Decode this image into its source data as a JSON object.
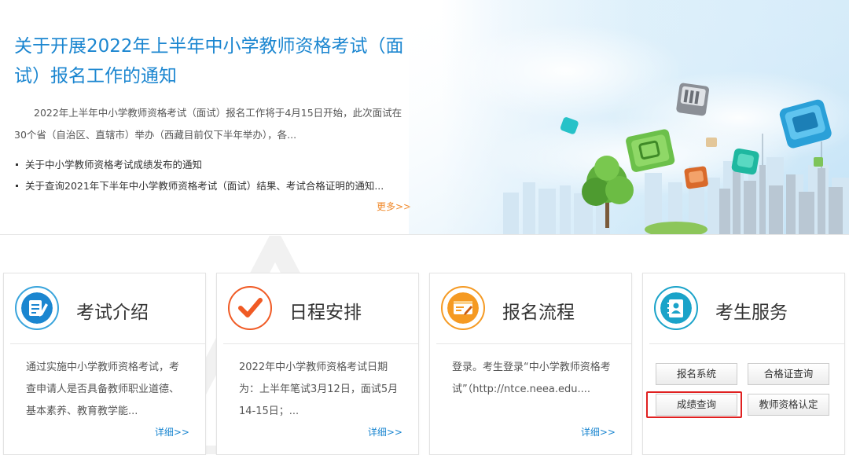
{
  "hero": {
    "title": "关于开展2022年上半年中小学教师资格考试（面试）报名工作的通知",
    "summary": "2022年上半年中小学教师资格考试（面试）报名工作将于4月15日开始，此次面试在30个省（自治区、直辖市）举办（西藏目前仅下半年举办），各...",
    "links": [
      "关于中小学教师资格考试成绩发布的通知",
      "关于查询2021年下半年中小学教师资格考试（面试）结果、考试合格证明的通知..."
    ],
    "more": "更多>>"
  },
  "cards": [
    {
      "title": "考试介绍",
      "icon": "document-pen-icon",
      "body": "通过实施中小学教师资格考试，考查申请人是否具备教师职业道德、基本素养、教育教学能...",
      "more": "详细>>",
      "color": "#1b86d0"
    },
    {
      "title": "日程安排",
      "icon": "checkmark-icon",
      "body": "2022年中小学教师资格考试日期为：上半年笔试3月12日，面试5月14-15日；...",
      "more": "详细>>",
      "color": "#f05a24"
    },
    {
      "title": "报名流程",
      "icon": "signup-form-icon",
      "body": "登录。考生登录“中小学教师资格考试”（http://ntce.neea.edu....",
      "more": "详细>>",
      "color": "#f59a23"
    },
    {
      "title": "考生服务",
      "icon": "contacts-book-icon",
      "color": "#1aa3c9",
      "buttons": [
        "报名系统",
        "合格证查询",
        "成绩查询",
        "教师资格认定"
      ]
    }
  ],
  "colors": {
    "accent": "#1b86d0",
    "more_orange": "#f08a2c",
    "highlight": "#e02020"
  }
}
